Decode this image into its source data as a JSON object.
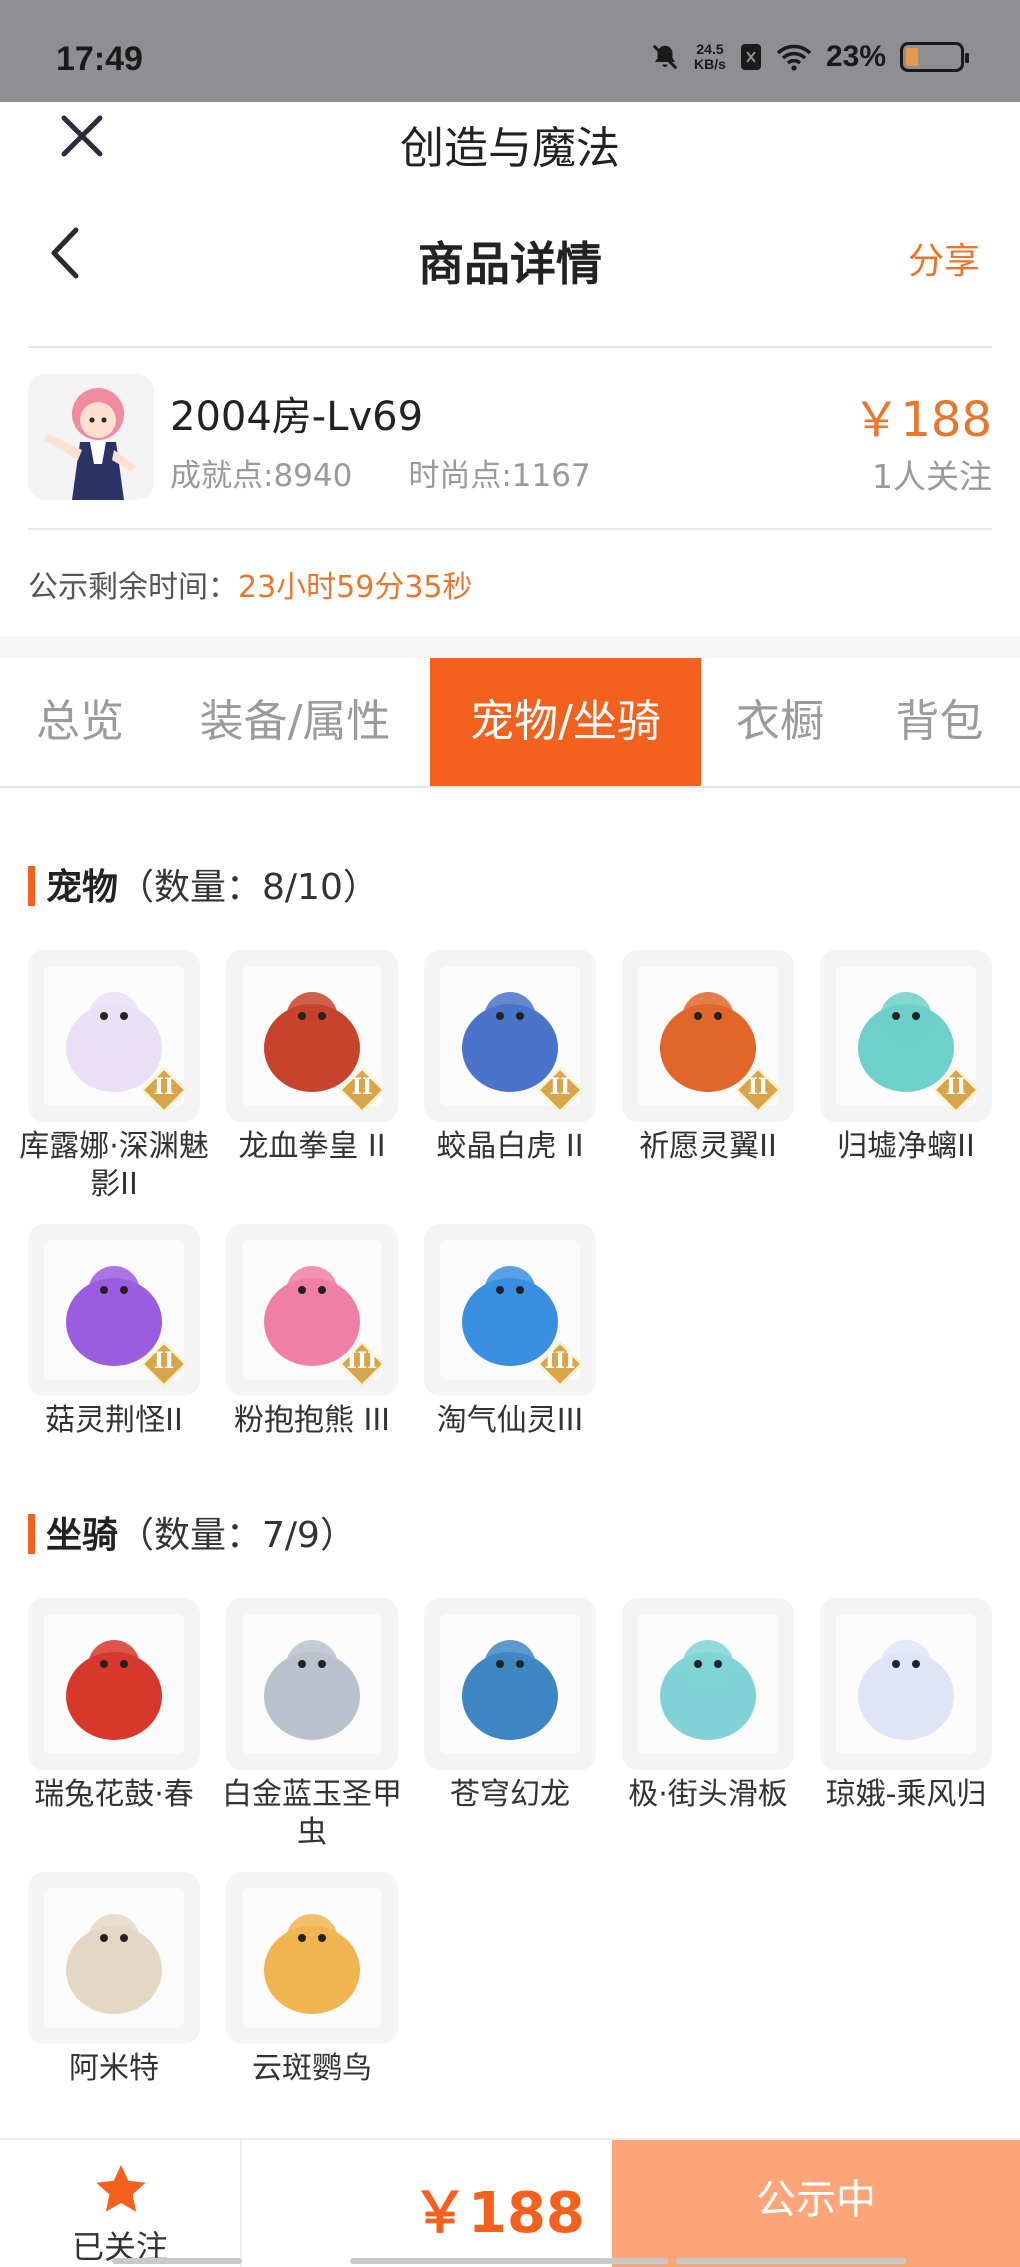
{
  "status_bar": {
    "time": "17:49",
    "net_speed_value": "24.5",
    "net_speed_unit": "KB/s",
    "battery_percent": "23%",
    "battery_level": 0.23
  },
  "app": {
    "title": "创造与魔法"
  },
  "nav": {
    "title": "商品详情",
    "share": "分享"
  },
  "item": {
    "name": "2004房-Lv69",
    "achievement": "成就点:8940",
    "fashion": "时尚点:1167",
    "price": "￥188",
    "followers": "1人关注"
  },
  "countdown": {
    "label": "公示剩余时间：",
    "time": "23小时59分35秒"
  },
  "tabs": [
    {
      "label": "总览"
    },
    {
      "label": "装备/属性"
    },
    {
      "label": "宠物/坐骑"
    },
    {
      "label": "衣橱"
    },
    {
      "label": "背包"
    }
  ],
  "active_tab": 2,
  "pets": {
    "title": "宠物",
    "count": "（数量：8/10）",
    "items": [
      {
        "name": "库露娜·深渊魅影II",
        "tier": "II",
        "icon": "pet-kuluna-icon",
        "color": "#e9e0f7"
      },
      {
        "name": "龙血拳皇 II",
        "tier": "II",
        "icon": "pet-dragon-boxer-icon",
        "color": "#c8432c"
      },
      {
        "name": "蛟晶白虎 II",
        "tier": "II",
        "icon": "pet-white-tiger-icon",
        "color": "#4a74c9"
      },
      {
        "name": "祈愿灵翼II",
        "tier": "II",
        "icon": "pet-spirit-wing-icon",
        "color": "#e0662a"
      },
      {
        "name": "归墟净螭II",
        "tier": "II",
        "icon": "pet-chi-dragon-icon",
        "color": "#6fcfc9"
      },
      {
        "name": "菇灵荆怪II",
        "tier": "II",
        "icon": "pet-mushroom-icon",
        "color": "#9c5ce0"
      },
      {
        "name": "粉抱抱熊 III",
        "tier": "III",
        "icon": "pet-pink-bear-icon",
        "color": "#f07fa6"
      },
      {
        "name": "淘气仙灵III",
        "tier": "III",
        "icon": "pet-blue-spirit-icon",
        "color": "#3a8fe0"
      }
    ]
  },
  "mounts": {
    "title": "坐骑",
    "count": "（数量：7/9）",
    "items": [
      {
        "name": "瑞兔花鼓·春",
        "icon": "mount-drum-icon",
        "color": "#d8382b"
      },
      {
        "name": "白金蓝玉圣甲虫",
        "icon": "mount-beetle-icon",
        "color": "#b8c2cc"
      },
      {
        "name": "苍穹幻龙",
        "icon": "mount-sky-dragon-icon",
        "color": "#3f87c4"
      },
      {
        "name": "极·街头滑板",
        "icon": "mount-skateboard-icon",
        "color": "#7fd3d6"
      },
      {
        "name": "琼娥-乘风归",
        "icon": "mount-fairy-icon",
        "color": "#dfe4f7"
      },
      {
        "name": "阿米特",
        "icon": "mount-crocodile-icon",
        "color": "#e4d8c4"
      },
      {
        "name": "云斑鹦鸟",
        "icon": "mount-parrot-icon",
        "color": "#f0b450"
      }
    ]
  },
  "bottom_bar": {
    "followed": "已关注",
    "price": "￥188",
    "status": "公示中"
  },
  "colors": {
    "accent": "#f4611e",
    "price": "#e8772e",
    "status_button": "#fca579"
  }
}
